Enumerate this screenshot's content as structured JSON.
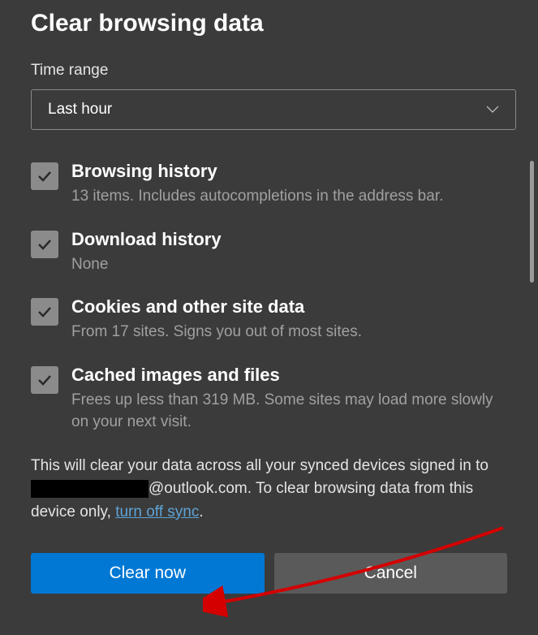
{
  "title": "Clear browsing data",
  "time_range": {
    "label": "Time range",
    "selected": "Last hour"
  },
  "options": [
    {
      "title": "Browsing history",
      "desc": "13 items. Includes autocompletions in the address bar.",
      "checked": true
    },
    {
      "title": "Download history",
      "desc": "None",
      "checked": true
    },
    {
      "title": "Cookies and other site data",
      "desc": "From 17 sites. Signs you out of most sites.",
      "checked": true
    },
    {
      "title": "Cached images and files",
      "desc": "Frees up less than 319 MB. Some sites may load more slowly on your next visit.",
      "checked": true
    }
  ],
  "sync_notice": {
    "part1": "This will clear your data across all your synced devices signed in to ",
    "email_domain": "@outlook.com. To clear browsing data from this device only, ",
    "link": "turn off sync",
    "part2": "."
  },
  "buttons": {
    "primary": "Clear now",
    "secondary": "Cancel"
  }
}
